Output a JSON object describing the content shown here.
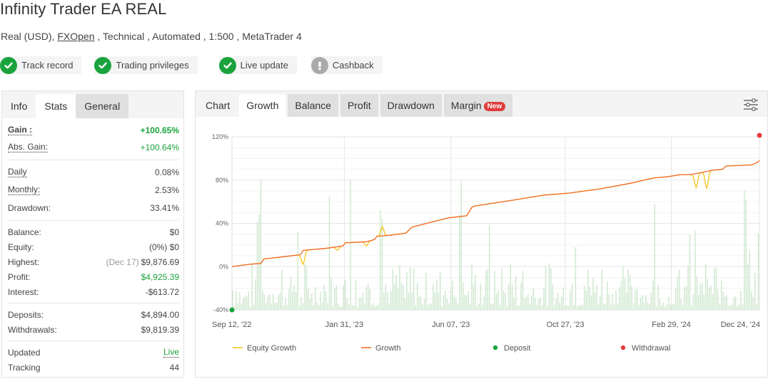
{
  "header": {
    "title": "Infinity Trader EA REAL",
    "subtitle_prefix": "Real (USD), ",
    "broker": "FXOpen",
    "subtitle_suffix": " , Technical , Automated , 1:500 , MetaTrader 4"
  },
  "badges": [
    {
      "label": "Track record",
      "icon": "check-icon",
      "status": "ok"
    },
    {
      "label": "Trading privileges",
      "icon": "check-icon",
      "status": "ok"
    },
    {
      "label": "Live update",
      "icon": "check-icon",
      "status": "ok"
    },
    {
      "label": "Cashback",
      "icon": "exclamation-icon",
      "status": "warn"
    }
  ],
  "left_tabs": [
    "Info",
    "Stats",
    "General"
  ],
  "stats": {
    "gain": {
      "label": "Gain :",
      "value": "+100.65%"
    },
    "abs_gain": {
      "label": "Abs. Gain:",
      "value": "+100.64%"
    },
    "daily": {
      "label": "Daily",
      "value": "0.08%"
    },
    "monthly": {
      "label": "Monthly:",
      "value": "2.53%"
    },
    "drawdown": {
      "label": "Drawdown:",
      "value": "33.41%"
    },
    "balance": {
      "label": "Balance:",
      "value": "$0"
    },
    "equity": {
      "label": "Equity:",
      "value": "(0%) $0"
    },
    "highest": {
      "label": "Highest:",
      "note": "(Dec 17)",
      "value": "$9,876.69"
    },
    "profit": {
      "label": "Profit:",
      "value": "$4,925.39"
    },
    "interest": {
      "label": "Interest:",
      "value": "-$613.72"
    },
    "deposits": {
      "label": "Deposits:",
      "value": "$4,894.00"
    },
    "withdrawals": {
      "label": "Withdrawals:",
      "value": "$9,819.39"
    },
    "updated": {
      "label": "Updated",
      "value": "Live"
    },
    "tracking": {
      "label": "Tracking",
      "value": "44"
    }
  },
  "right_tabs": [
    "Chart",
    "Growth",
    "Balance",
    "Profit",
    "Drawdown",
    "Margin"
  ],
  "new_badge": "New",
  "colors": {
    "green": "#1aa33c",
    "growth": "#f06a2a",
    "equity": "#f5c518",
    "bars": "#cfe8cf",
    "deposit": "#1aa33c",
    "withdrawal": "#e83b3b"
  },
  "chart_data": {
    "type": "line",
    "title": "Growth",
    "ylabel": "",
    "xlabel": "",
    "ylim": [
      -40,
      120
    ],
    "yticks": [
      "120%",
      "80%",
      "40%",
      "0%",
      "-40%"
    ],
    "ytick_values": [
      120,
      80,
      40,
      0,
      -40
    ],
    "xticks": [
      "Sep 12, '22",
      "Jan 31, '23",
      "Jun 07, '23",
      "Oct 27, '23",
      "Feb 29, '24",
      "Dec 24, '24"
    ],
    "xtick_positions": [
      0,
      0.213,
      0.415,
      0.632,
      0.833,
      1.0
    ],
    "legend": [
      "Equity Growth",
      "Growth",
      "Deposit",
      "Withdrawal"
    ],
    "legend_position": "bottom",
    "series": [
      {
        "name": "Growth",
        "x": [
          0,
          0.03,
          0.055,
          0.06,
          0.095,
          0.13,
          0.135,
          0.18,
          0.21,
          0.215,
          0.255,
          0.27,
          0.275,
          0.3,
          0.33,
          0.34,
          0.345,
          0.41,
          0.445,
          0.455,
          0.46,
          0.54,
          0.59,
          0.64,
          0.7,
          0.755,
          0.8,
          0.825,
          0.85,
          0.87,
          0.91,
          0.93,
          0.937,
          0.985,
          0.99,
          0.995,
          1.0
        ],
        "y": [
          0,
          2,
          3,
          7,
          9,
          11,
          15,
          17,
          19,
          22,
          23,
          25,
          28,
          29,
          31,
          36,
          37,
          45,
          47,
          55,
          56,
          62,
          66,
          68,
          72,
          77,
          82,
          83,
          85,
          85,
          89,
          90,
          93,
          94,
          95,
          96,
          98
        ]
      },
      {
        "name": "Equity Growth",
        "note": "follows Growth with dips",
        "dips": [
          {
            "x": 0.135,
            "y": 2
          },
          {
            "x": 0.2,
            "y": 15
          },
          {
            "x": 0.255,
            "y": 19
          },
          {
            "x": 0.285,
            "y": 37
          },
          {
            "x": 0.88,
            "y": 73
          },
          {
            "x": 0.9,
            "y": 72
          }
        ]
      },
      {
        "name": "Deposit",
        "points": [
          {
            "x": 0,
            "y": -40
          }
        ]
      },
      {
        "name": "Withdrawal",
        "points": [
          {
            "x": 1.0,
            "y": 120
          }
        ]
      }
    ],
    "bars_series": {
      "name": "daily activity (background bars)",
      "note": "light-green background bars, heights on the same % axis roughly -40% to 80%"
    }
  }
}
